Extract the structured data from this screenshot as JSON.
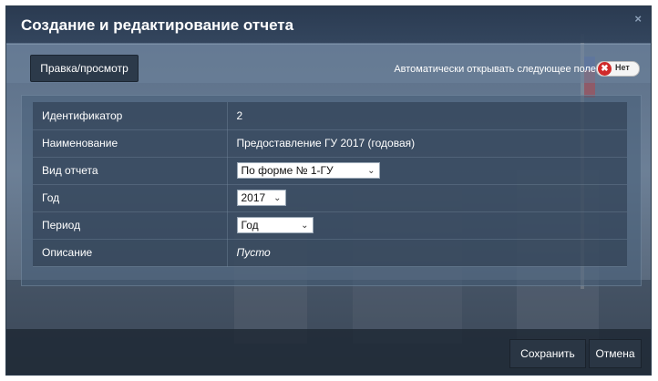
{
  "dialog": {
    "title": "Создание и редактирование отчета",
    "close_glyph": "×"
  },
  "toolbar": {
    "edit_view_label": "Правка/просмотр",
    "auto_open_label": "Автоматически открывать следующее поле",
    "toggle_off_glyph": "✖",
    "toggle_state_label": "Нет"
  },
  "form": {
    "rows": [
      {
        "label": "Идентификатор",
        "value": "2"
      },
      {
        "label": "Наименование",
        "value": "Предоставление ГУ 2017 (годовая)"
      },
      {
        "label": "Вид отчета",
        "value": "По форме № 1-ГУ"
      },
      {
        "label": "Год",
        "value": "2017"
      },
      {
        "label": "Период",
        "value": "Год"
      },
      {
        "label": "Описание",
        "value": "Пусто"
      }
    ]
  },
  "footer": {
    "save_label": "Сохранить",
    "cancel_label": "Отмена"
  },
  "colors": {
    "accent_red": "#d02a2a",
    "panel": "#465c76",
    "button": "#2a3644"
  },
  "icons": {
    "close": "close-icon",
    "dropdown": "chevron-down-icon"
  }
}
